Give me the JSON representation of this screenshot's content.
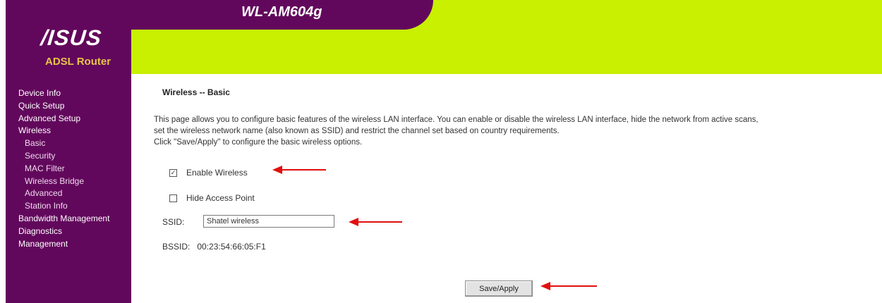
{
  "header": {
    "model": "WL-AM604g",
    "brand_logo": "/ISUS",
    "brand_sub": "ADSL Router"
  },
  "sidebar": {
    "items": [
      {
        "label": "Device Info",
        "sub": false
      },
      {
        "label": "Quick Setup",
        "sub": false
      },
      {
        "label": "Advanced Setup",
        "sub": false
      },
      {
        "label": "Wireless",
        "sub": false
      },
      {
        "label": "Basic",
        "sub": true
      },
      {
        "label": "Security",
        "sub": true
      },
      {
        "label": "MAC Filter",
        "sub": true
      },
      {
        "label": "Wireless Bridge",
        "sub": true
      },
      {
        "label": "Advanced",
        "sub": true
      },
      {
        "label": "Station Info",
        "sub": true
      },
      {
        "label": "Bandwidth Management",
        "sub": false
      },
      {
        "label": "Diagnostics",
        "sub": false
      },
      {
        "label": "Management",
        "sub": false
      }
    ]
  },
  "main": {
    "title": "Wireless -- Basic",
    "description": [
      "This page allows you to configure basic features of the wireless LAN interface. You can enable or disable the wireless LAN interface, hide the network from active scans,",
      "set the wireless network name (also known as SSID) and restrict the channel set based on country requirements.",
      "Click \"Save/Apply\" to configure the basic wireless options."
    ],
    "enable_wireless": {
      "label": "Enable Wireless",
      "checked": true,
      "mark": "✓"
    },
    "hide_access_point": {
      "label": "Hide Access Point",
      "checked": false
    },
    "ssid": {
      "label": "SSID:",
      "value": "Shatel wireless"
    },
    "bssid": {
      "label": "BSSID:",
      "value": "00:23:54:66:05:F1"
    },
    "save_button": "Save/Apply"
  },
  "colors": {
    "sidebar": "#62085c",
    "banner": "#c8f000",
    "arrow": "#e01010"
  },
  "icons": [
    "arrow-left-icon",
    "checkbox-icon"
  ]
}
